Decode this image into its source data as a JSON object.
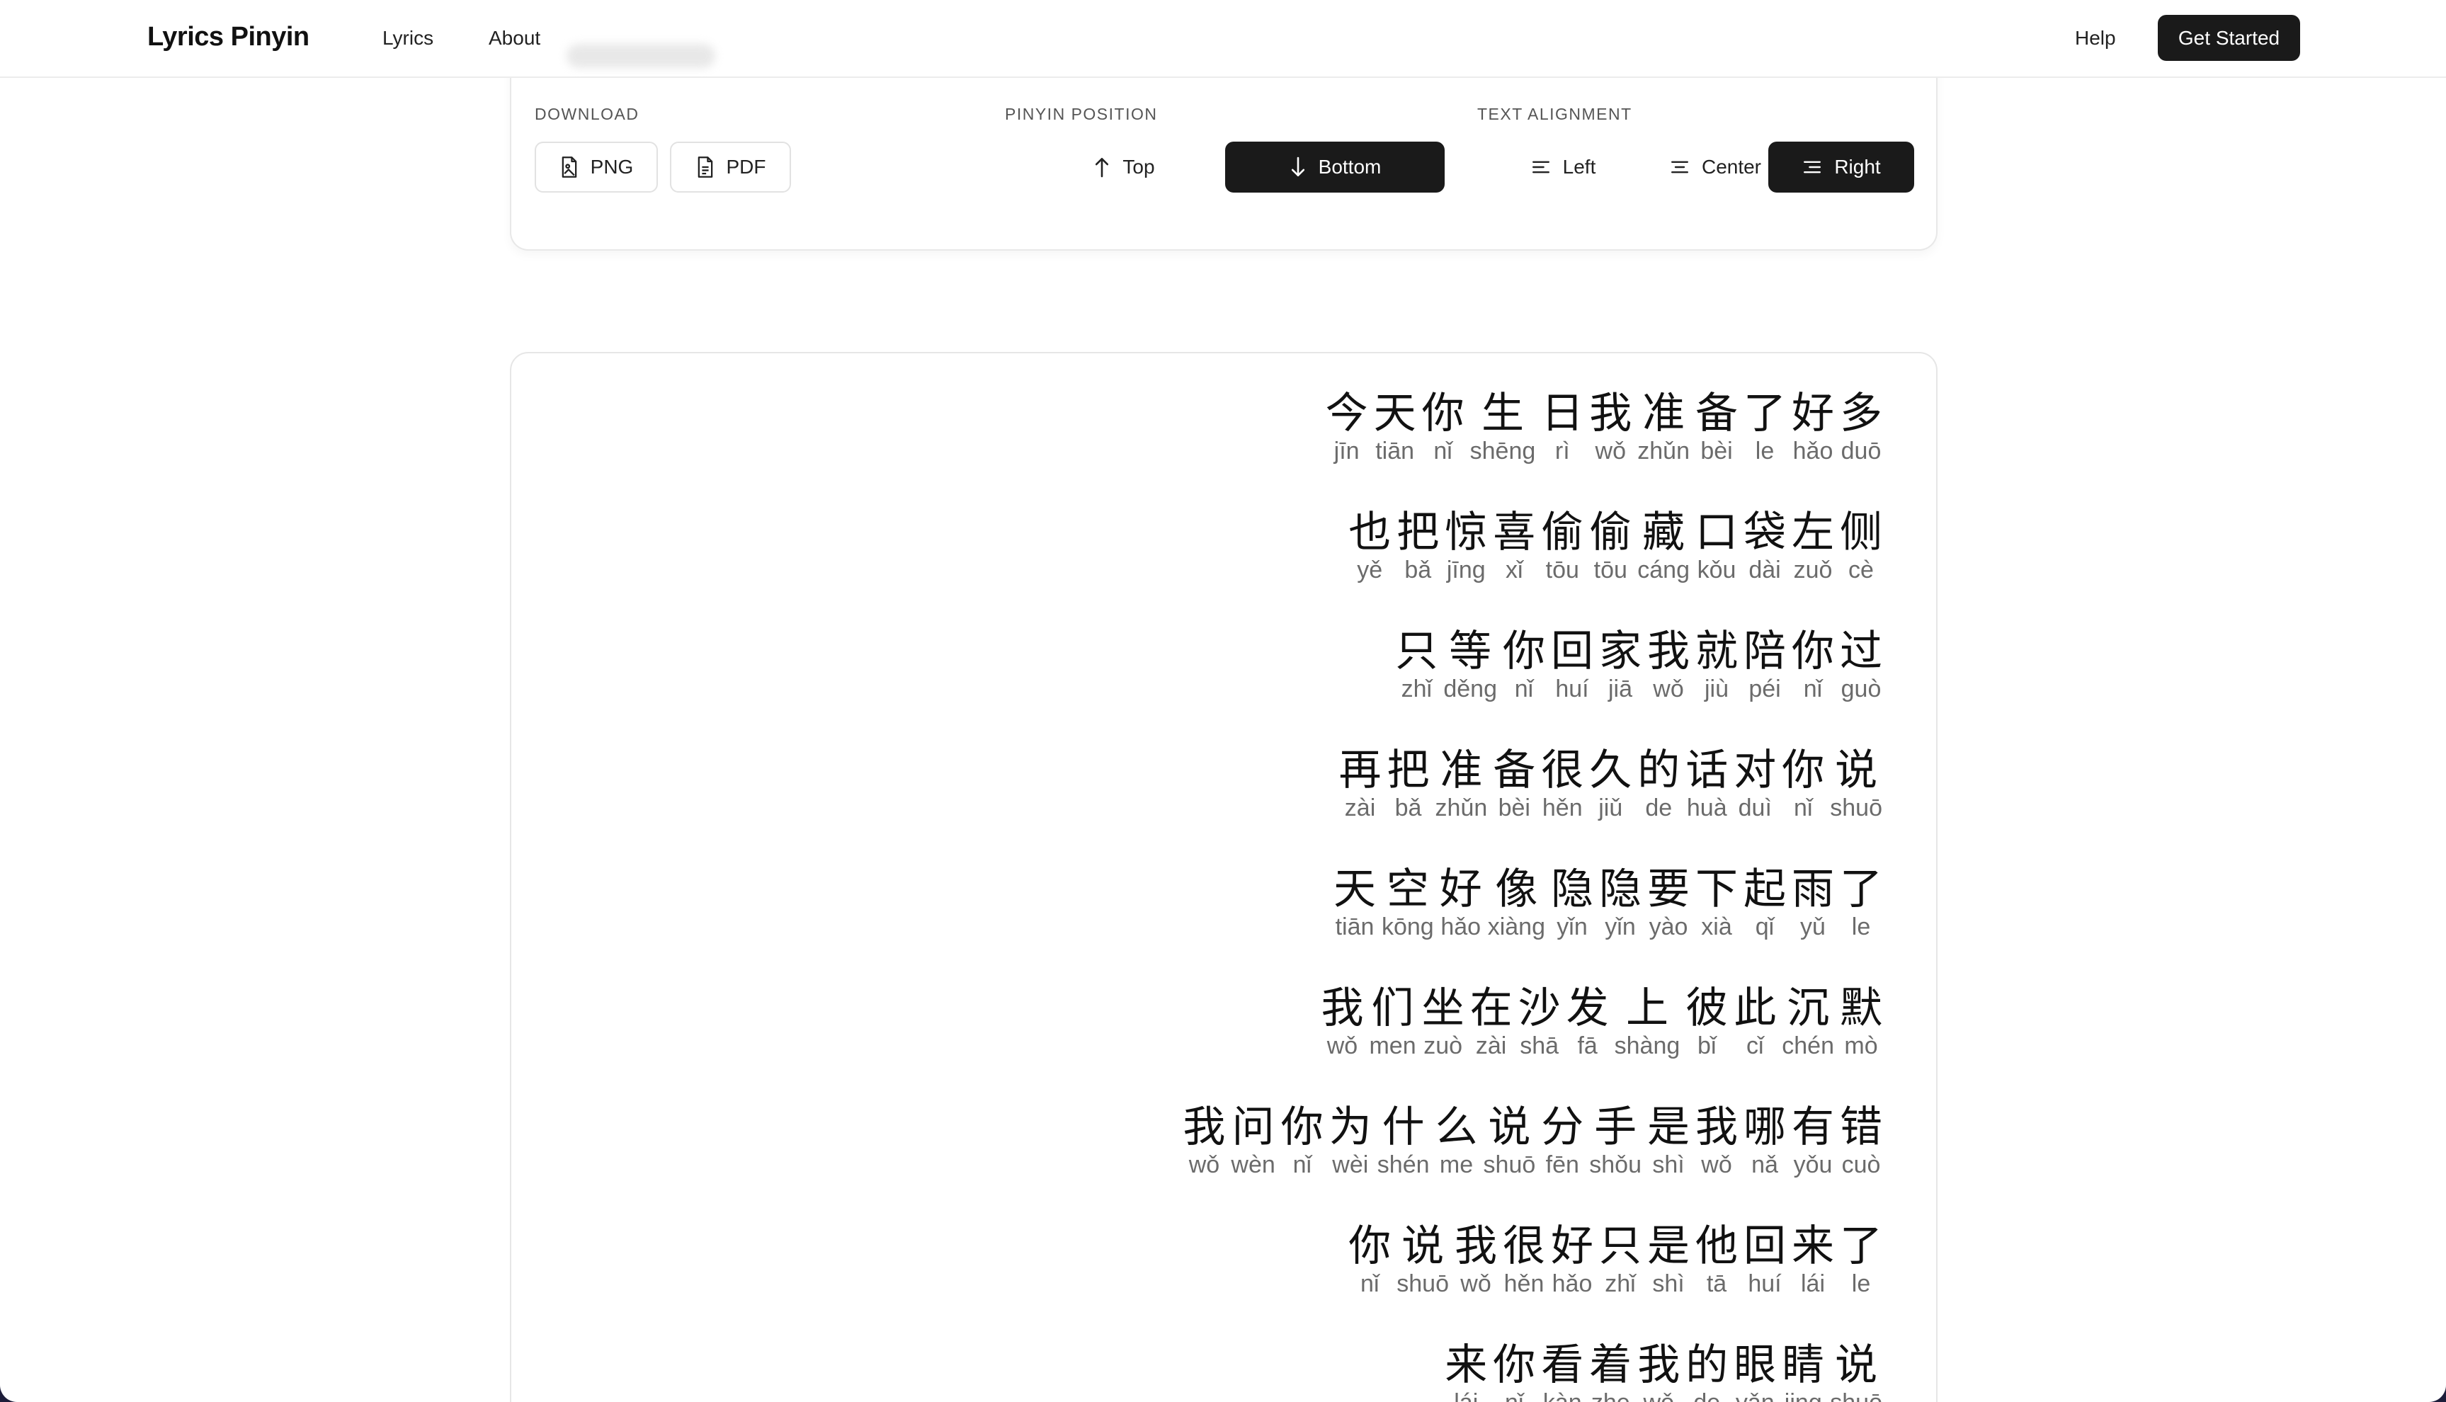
{
  "header": {
    "brand": "Lyrics Pinyin",
    "nav": {
      "lyrics": "Lyrics",
      "about": "About"
    },
    "help": "Help",
    "cta": "Get Started"
  },
  "toolbar": {
    "download": {
      "label": "DOWNLOAD",
      "png": "PNG",
      "pdf": "PDF"
    },
    "pinyin_position": {
      "label": "PINYIN POSITION",
      "top": "Top",
      "bottom": "Bottom",
      "selected": "Bottom"
    },
    "text_alignment": {
      "label": "TEXT ALIGNMENT",
      "left": "Left",
      "center": "Center",
      "right": "Right",
      "selected": "Right"
    }
  },
  "lyrics": {
    "alignment": "right",
    "lines": [
      [
        [
          "今",
          "jīn"
        ],
        [
          "天",
          "tiān"
        ],
        [
          "你",
          "nǐ"
        ],
        [
          "生",
          "shēng"
        ],
        [
          "日",
          "rì"
        ],
        [
          "我",
          "wǒ"
        ],
        [
          "准",
          "zhǔn"
        ],
        [
          "备",
          "bèi"
        ],
        [
          "了",
          "le"
        ],
        [
          "好",
          "hǎo"
        ],
        [
          "多",
          "duō"
        ]
      ],
      [
        [
          "也",
          "yě"
        ],
        [
          "把",
          "bǎ"
        ],
        [
          "惊",
          "jīng"
        ],
        [
          "喜",
          "xǐ"
        ],
        [
          "偷",
          "tōu"
        ],
        [
          "偷",
          "tōu"
        ],
        [
          "藏",
          "cáng"
        ],
        [
          "口",
          "kǒu"
        ],
        [
          "袋",
          "dài"
        ],
        [
          "左",
          "zuǒ"
        ],
        [
          "侧",
          "cè"
        ]
      ],
      [
        [
          "只",
          "zhǐ"
        ],
        [
          "等",
          "děng"
        ],
        [
          "你",
          "nǐ"
        ],
        [
          "回",
          "huí"
        ],
        [
          "家",
          "jiā"
        ],
        [
          "我",
          "wǒ"
        ],
        [
          "就",
          "jiù"
        ],
        [
          "陪",
          "péi"
        ],
        [
          "你",
          "nǐ"
        ],
        [
          "过",
          "guò"
        ]
      ],
      [
        [
          "再",
          "zài"
        ],
        [
          "把",
          "bǎ"
        ],
        [
          "准",
          "zhǔn"
        ],
        [
          "备",
          "bèi"
        ],
        [
          "很",
          "hěn"
        ],
        [
          "久",
          "jiǔ"
        ],
        [
          "的",
          "de"
        ],
        [
          "话",
          "huà"
        ],
        [
          "对",
          "duì"
        ],
        [
          "你",
          "nǐ"
        ],
        [
          "说",
          "shuō"
        ]
      ],
      [
        [
          "天",
          "tiān"
        ],
        [
          "空",
          "kōng"
        ],
        [
          "好",
          "hǎo"
        ],
        [
          "像",
          "xiàng"
        ],
        [
          "隐",
          "yǐn"
        ],
        [
          "隐",
          "yǐn"
        ],
        [
          "要",
          "yào"
        ],
        [
          "下",
          "xià"
        ],
        [
          "起",
          "qǐ"
        ],
        [
          "雨",
          "yǔ"
        ],
        [
          "了",
          "le"
        ]
      ],
      [
        [
          "我",
          "wǒ"
        ],
        [
          "们",
          "men"
        ],
        [
          "坐",
          "zuò"
        ],
        [
          "在",
          "zài"
        ],
        [
          "沙",
          "shā"
        ],
        [
          "发",
          "fā"
        ],
        [
          "上",
          "shàng"
        ],
        [
          "彼",
          "bǐ"
        ],
        [
          "此",
          "cǐ"
        ],
        [
          "沉",
          "chén"
        ],
        [
          "默",
          "mò"
        ]
      ],
      [
        [
          "我",
          "wǒ"
        ],
        [
          "问",
          "wèn"
        ],
        [
          "你",
          "nǐ"
        ],
        [
          "为",
          "wèi"
        ],
        [
          "什",
          "shén"
        ],
        [
          "么",
          "me"
        ],
        [
          "说",
          "shuō"
        ],
        [
          "分",
          "fēn"
        ],
        [
          "手",
          "shǒu"
        ],
        [
          "是",
          "shì"
        ],
        [
          "我",
          "wǒ"
        ],
        [
          "哪",
          "nǎ"
        ],
        [
          "有",
          "yǒu"
        ],
        [
          "错",
          "cuò"
        ]
      ],
      [
        [
          "你",
          "nǐ"
        ],
        [
          "说",
          "shuō"
        ],
        [
          "我",
          "wǒ"
        ],
        [
          "很",
          "hěn"
        ],
        [
          "好",
          "hǎo"
        ],
        [
          "只",
          "zhǐ"
        ],
        [
          "是",
          "shì"
        ],
        [
          "他",
          "tā"
        ],
        [
          "回",
          "huí"
        ],
        [
          "来",
          "lái"
        ],
        [
          "了",
          "le"
        ]
      ],
      [
        [
          "来",
          "lái"
        ],
        [
          "你",
          "nǐ"
        ],
        [
          "看",
          "kàn"
        ],
        [
          "着",
          "zhe"
        ],
        [
          "我",
          "wǒ"
        ],
        [
          "的",
          "de"
        ],
        [
          "眼",
          "yǎn"
        ],
        [
          "睛",
          "jing"
        ],
        [
          "说",
          "shuō"
        ]
      ]
    ]
  },
  "colors": {
    "primary": "#1a1a1a",
    "border": "#e6e6e6",
    "pinyin": "#6b6b6b"
  },
  "icons": [
    "file-image-icon",
    "file-text-icon",
    "arrow-up-icon",
    "arrow-down-icon",
    "align-left-icon",
    "align-center-icon",
    "align-right-icon"
  ]
}
